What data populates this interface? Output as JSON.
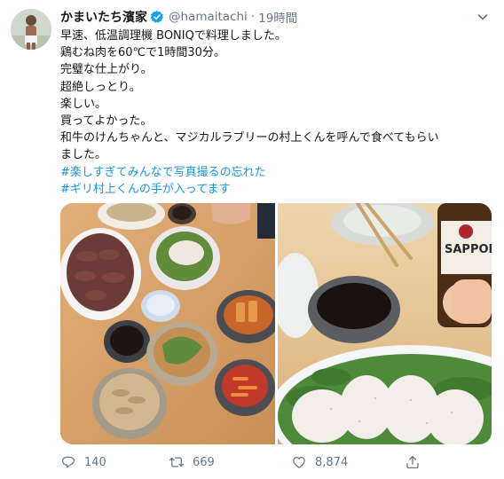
{
  "tweet": {
    "display_name": "かまいたち濱家",
    "handle": "@hamaitachi",
    "separator": "·",
    "timestamp": "19時間",
    "lines": [
      "早速、低温調理機 BONIQで料理しました。",
      "鶏むね肉を60℃で1時間30分。",
      "完璧な仕上がり。",
      "超絶しっとり。",
      "楽しい。",
      "買ってよかった。",
      "和牛のけんちゃんと、マジカルラブリーの村上くんを呼んで食べてもらい",
      "ました。"
    ],
    "hashtags": [
      "#楽しすぎてみんなで写真撮るの忘れた",
      "#ギリ村上くんの手が入ってます"
    ],
    "bottle_label": "SAPPOR",
    "reply_count": "140",
    "retweet_count": "669",
    "like_count": "8,874",
    "icons": {
      "verified": "verified-badge-icon",
      "more": "chevron-down-icon",
      "reply": "reply-icon",
      "retweet": "retweet-icon",
      "like": "heart-icon",
      "share": "share-icon"
    },
    "colors": {
      "text": "#14171a",
      "secondary": "#657786",
      "link": "#1b95e0",
      "verified": "#1da1f2"
    }
  }
}
